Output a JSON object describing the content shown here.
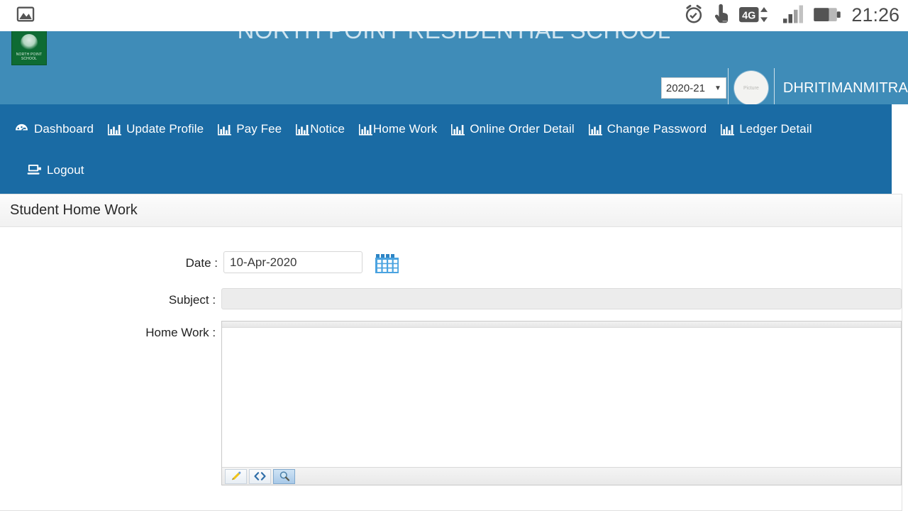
{
  "statusbar": {
    "time": "21:26",
    "icons": [
      {
        "name": "gallery-image-icon"
      },
      {
        "name": "alarm-clock-icon"
      },
      {
        "name": "touch-pointer-icon"
      },
      {
        "name": "4g-data-icon",
        "label": "4G"
      },
      {
        "name": "signal-bars-icon"
      },
      {
        "name": "battery-icon"
      }
    ]
  },
  "header": {
    "logo_name": "north-point-residential-school-logo",
    "logo_crest_text": "NORTH POINT\nSCHOOL",
    "school_name": "NORTH POINT RESIDENTIAL SCHOOL",
    "year_value": "2020-21",
    "year_caret": "▼",
    "avatar_placeholder": "Picture",
    "username": "DHRITIMANMITRA"
  },
  "nav": {
    "row1": [
      {
        "label": "Dashboard",
        "icon": "dashboard-icon",
        "tight": false
      },
      {
        "label": "Update Profile",
        "icon": "bar-chart-icon",
        "tight": false
      },
      {
        "label": "Pay Fee",
        "icon": "bar-chart-icon",
        "tight": false
      },
      {
        "label": "Notice",
        "icon": "bar-chart-icon",
        "tight": true
      },
      {
        "label": "Home Work",
        "icon": "bar-chart-icon",
        "tight": true
      },
      {
        "label": "Online Order Detail",
        "icon": "bar-chart-icon",
        "tight": false
      },
      {
        "label": "Change Password",
        "icon": "bar-chart-icon",
        "tight": false
      },
      {
        "label": "Ledger Detail",
        "icon": "bar-chart-icon",
        "tight": false
      }
    ],
    "row2": [
      {
        "label": "Logout",
        "icon": "logout-screen-icon",
        "tight": false
      }
    ]
  },
  "panel": {
    "title": "Student Home Work",
    "fields": {
      "date_label": "Date :",
      "date_value": "10-Apr-2020",
      "date_placeholder": "",
      "calendar_button_name": "calendar-picker-button",
      "subject_label": "Subject :",
      "subject_value": "",
      "subject_placeholder": "",
      "homework_label": "Home Work :",
      "homework_value": ""
    },
    "editor_toolbar": [
      {
        "name": "design-mode-button",
        "icon": "pencil-icon",
        "active": false
      },
      {
        "name": "html-source-button",
        "icon": "code-brackets-icon",
        "active": false
      },
      {
        "name": "preview-button",
        "icon": "magnifier-icon",
        "active": true
      }
    ]
  },
  "colors": {
    "header_blue": "#3f8cb8",
    "nav_blue": "#1a6ba4",
    "accent_calendar": "#3d9ad6",
    "logo_green": "#0e6b33"
  }
}
